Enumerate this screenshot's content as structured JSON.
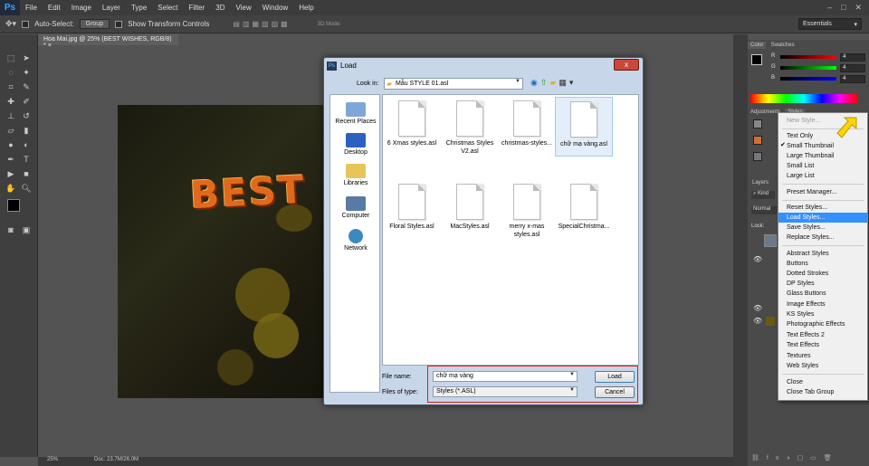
{
  "app": {
    "logo": "Ps",
    "menu": [
      "File",
      "Edit",
      "Image",
      "Layer",
      "Type",
      "Select",
      "Filter",
      "3D",
      "View",
      "Window",
      "Help"
    ]
  },
  "options": {
    "auto_select": "Auto-Select:",
    "group": "Group",
    "show_transform": "Show Transform Controls",
    "mode3d": "3D Mode:",
    "workspace": "Essentials"
  },
  "document": {
    "tab": "Hoa Mai.jpg @ 25% (BEST WISHES, RGB/8) *",
    "canvas_text": "BEST"
  },
  "status": {
    "zoom": "25%",
    "doc": "Doc: 23.7M/26.0M"
  },
  "color_panel": {
    "tabs": [
      "Color",
      "Swatches"
    ],
    "labels": [
      "R",
      "G",
      "B"
    ],
    "values": [
      "4",
      "4",
      "4"
    ]
  },
  "styles_panel": {
    "tabs": [
      "Adjustments",
      "Styles"
    ],
    "layers": "Layers",
    "kind": "Kind",
    "normal": "Normal",
    "lock": "Lock:"
  },
  "flymenu": {
    "items": [
      "New Style...",
      "Text Only",
      "Small Thumbnail",
      "Large Thumbnail",
      "Small List",
      "Large List",
      "Preset Manager...",
      "Reset Styles...",
      "Load Styles...",
      "Save Styles...",
      "Replace Styles...",
      "Abstract Styles",
      "Buttons",
      "Dotted Strokes",
      "DP Styles",
      "Glass Buttons",
      "Image Effects",
      "KS Styles",
      "Photographic Effects",
      "Text Effects 2",
      "Text Effects",
      "Textures",
      "Web Styles",
      "Close",
      "Close Tab Group"
    ],
    "checked": "Small Thumbnail",
    "highlighted": "Load Styles...",
    "disabled": "New Style..."
  },
  "dialog": {
    "title": "Load",
    "close": "x",
    "look_in_label": "Look in:",
    "look_in": "Mẫu STYLE 01.asl",
    "places": [
      "Recent Places",
      "Desktop",
      "Libraries",
      "Computer",
      "Network"
    ],
    "files": [
      "6 Xmas styles.asl",
      "Christmas Styles V2.asl",
      "christmas-styles...",
      "chữ mạ vàng.asl",
      "Floral Styles.asl",
      "MacStyles.asl",
      "merry x-mas styles.asl",
      "SpecialChristma..."
    ],
    "selected_file": "chữ mạ vàng.asl",
    "file_name_label": "File name:",
    "file_name": "chữ mạ vàng",
    "file_type_label": "Files of type:",
    "file_type": "Styles (*.ASL)",
    "load": "Load",
    "cancel": "Cancel"
  }
}
